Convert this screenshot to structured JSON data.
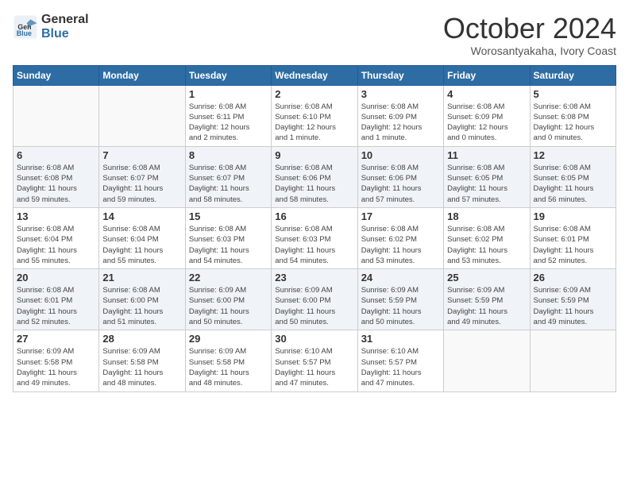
{
  "logo": {
    "general": "General",
    "blue": "Blue"
  },
  "title": "October 2024",
  "location": "Worosantyakaha, Ivory Coast",
  "weekdays": [
    "Sunday",
    "Monday",
    "Tuesday",
    "Wednesday",
    "Thursday",
    "Friday",
    "Saturday"
  ],
  "weeks": [
    [
      {
        "day": "",
        "info": ""
      },
      {
        "day": "",
        "info": ""
      },
      {
        "day": "1",
        "info": "Sunrise: 6:08 AM\nSunset: 6:11 PM\nDaylight: 12 hours\nand 2 minutes."
      },
      {
        "day": "2",
        "info": "Sunrise: 6:08 AM\nSunset: 6:10 PM\nDaylight: 12 hours\nand 1 minute."
      },
      {
        "day": "3",
        "info": "Sunrise: 6:08 AM\nSunset: 6:09 PM\nDaylight: 12 hours\nand 1 minute."
      },
      {
        "day": "4",
        "info": "Sunrise: 6:08 AM\nSunset: 6:09 PM\nDaylight: 12 hours\nand 0 minutes."
      },
      {
        "day": "5",
        "info": "Sunrise: 6:08 AM\nSunset: 6:08 PM\nDaylight: 12 hours\nand 0 minutes."
      }
    ],
    [
      {
        "day": "6",
        "info": "Sunrise: 6:08 AM\nSunset: 6:08 PM\nDaylight: 11 hours\nand 59 minutes."
      },
      {
        "day": "7",
        "info": "Sunrise: 6:08 AM\nSunset: 6:07 PM\nDaylight: 11 hours\nand 59 minutes."
      },
      {
        "day": "8",
        "info": "Sunrise: 6:08 AM\nSunset: 6:07 PM\nDaylight: 11 hours\nand 58 minutes."
      },
      {
        "day": "9",
        "info": "Sunrise: 6:08 AM\nSunset: 6:06 PM\nDaylight: 11 hours\nand 58 minutes."
      },
      {
        "day": "10",
        "info": "Sunrise: 6:08 AM\nSunset: 6:06 PM\nDaylight: 11 hours\nand 57 minutes."
      },
      {
        "day": "11",
        "info": "Sunrise: 6:08 AM\nSunset: 6:05 PM\nDaylight: 11 hours\nand 57 minutes."
      },
      {
        "day": "12",
        "info": "Sunrise: 6:08 AM\nSunset: 6:05 PM\nDaylight: 11 hours\nand 56 minutes."
      }
    ],
    [
      {
        "day": "13",
        "info": "Sunrise: 6:08 AM\nSunset: 6:04 PM\nDaylight: 11 hours\nand 55 minutes."
      },
      {
        "day": "14",
        "info": "Sunrise: 6:08 AM\nSunset: 6:04 PM\nDaylight: 11 hours\nand 55 minutes."
      },
      {
        "day": "15",
        "info": "Sunrise: 6:08 AM\nSunset: 6:03 PM\nDaylight: 11 hours\nand 54 minutes."
      },
      {
        "day": "16",
        "info": "Sunrise: 6:08 AM\nSunset: 6:03 PM\nDaylight: 11 hours\nand 54 minutes."
      },
      {
        "day": "17",
        "info": "Sunrise: 6:08 AM\nSunset: 6:02 PM\nDaylight: 11 hours\nand 53 minutes."
      },
      {
        "day": "18",
        "info": "Sunrise: 6:08 AM\nSunset: 6:02 PM\nDaylight: 11 hours\nand 53 minutes."
      },
      {
        "day": "19",
        "info": "Sunrise: 6:08 AM\nSunset: 6:01 PM\nDaylight: 11 hours\nand 52 minutes."
      }
    ],
    [
      {
        "day": "20",
        "info": "Sunrise: 6:08 AM\nSunset: 6:01 PM\nDaylight: 11 hours\nand 52 minutes."
      },
      {
        "day": "21",
        "info": "Sunrise: 6:08 AM\nSunset: 6:00 PM\nDaylight: 11 hours\nand 51 minutes."
      },
      {
        "day": "22",
        "info": "Sunrise: 6:09 AM\nSunset: 6:00 PM\nDaylight: 11 hours\nand 50 minutes."
      },
      {
        "day": "23",
        "info": "Sunrise: 6:09 AM\nSunset: 6:00 PM\nDaylight: 11 hours\nand 50 minutes."
      },
      {
        "day": "24",
        "info": "Sunrise: 6:09 AM\nSunset: 5:59 PM\nDaylight: 11 hours\nand 50 minutes."
      },
      {
        "day": "25",
        "info": "Sunrise: 6:09 AM\nSunset: 5:59 PM\nDaylight: 11 hours\nand 49 minutes."
      },
      {
        "day": "26",
        "info": "Sunrise: 6:09 AM\nSunset: 5:59 PM\nDaylight: 11 hours\nand 49 minutes."
      }
    ],
    [
      {
        "day": "27",
        "info": "Sunrise: 6:09 AM\nSunset: 5:58 PM\nDaylight: 11 hours\nand 49 minutes."
      },
      {
        "day": "28",
        "info": "Sunrise: 6:09 AM\nSunset: 5:58 PM\nDaylight: 11 hours\nand 48 minutes."
      },
      {
        "day": "29",
        "info": "Sunrise: 6:09 AM\nSunset: 5:58 PM\nDaylight: 11 hours\nand 48 minutes."
      },
      {
        "day": "30",
        "info": "Sunrise: 6:10 AM\nSunset: 5:57 PM\nDaylight: 11 hours\nand 47 minutes."
      },
      {
        "day": "31",
        "info": "Sunrise: 6:10 AM\nSunset: 5:57 PM\nDaylight: 11 hours\nand 47 minutes."
      },
      {
        "day": "",
        "info": ""
      },
      {
        "day": "",
        "info": ""
      }
    ]
  ]
}
